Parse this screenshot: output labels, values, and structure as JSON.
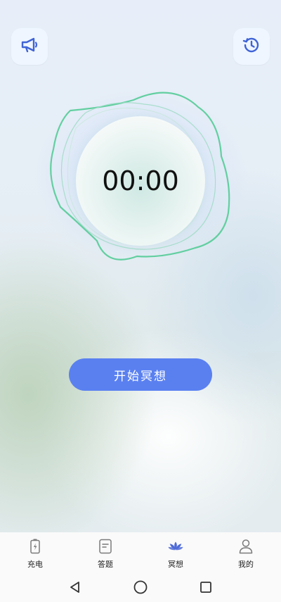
{
  "header": {
    "left_icon": "megaphone-icon",
    "right_icon": "history-icon"
  },
  "timer": {
    "display": "00:00"
  },
  "actions": {
    "start_label": "开始冥想"
  },
  "tabs": [
    {
      "label": "充电",
      "icon": "charging-battery-icon",
      "active": false
    },
    {
      "label": "答题",
      "icon": "quiz-document-icon",
      "active": false
    },
    {
      "label": "冥想",
      "icon": "lotus-icon",
      "active": true
    },
    {
      "label": "我的",
      "icon": "profile-icon",
      "active": false
    }
  ],
  "system_nav": {
    "back_icon": "back-triangle-icon",
    "home_icon": "home-circle-icon",
    "recents_icon": "recents-square-icon"
  },
  "colors": {
    "accent": "#5a80f0",
    "wave": "#62cfa0",
    "active_tab": "#4f6bd8"
  }
}
